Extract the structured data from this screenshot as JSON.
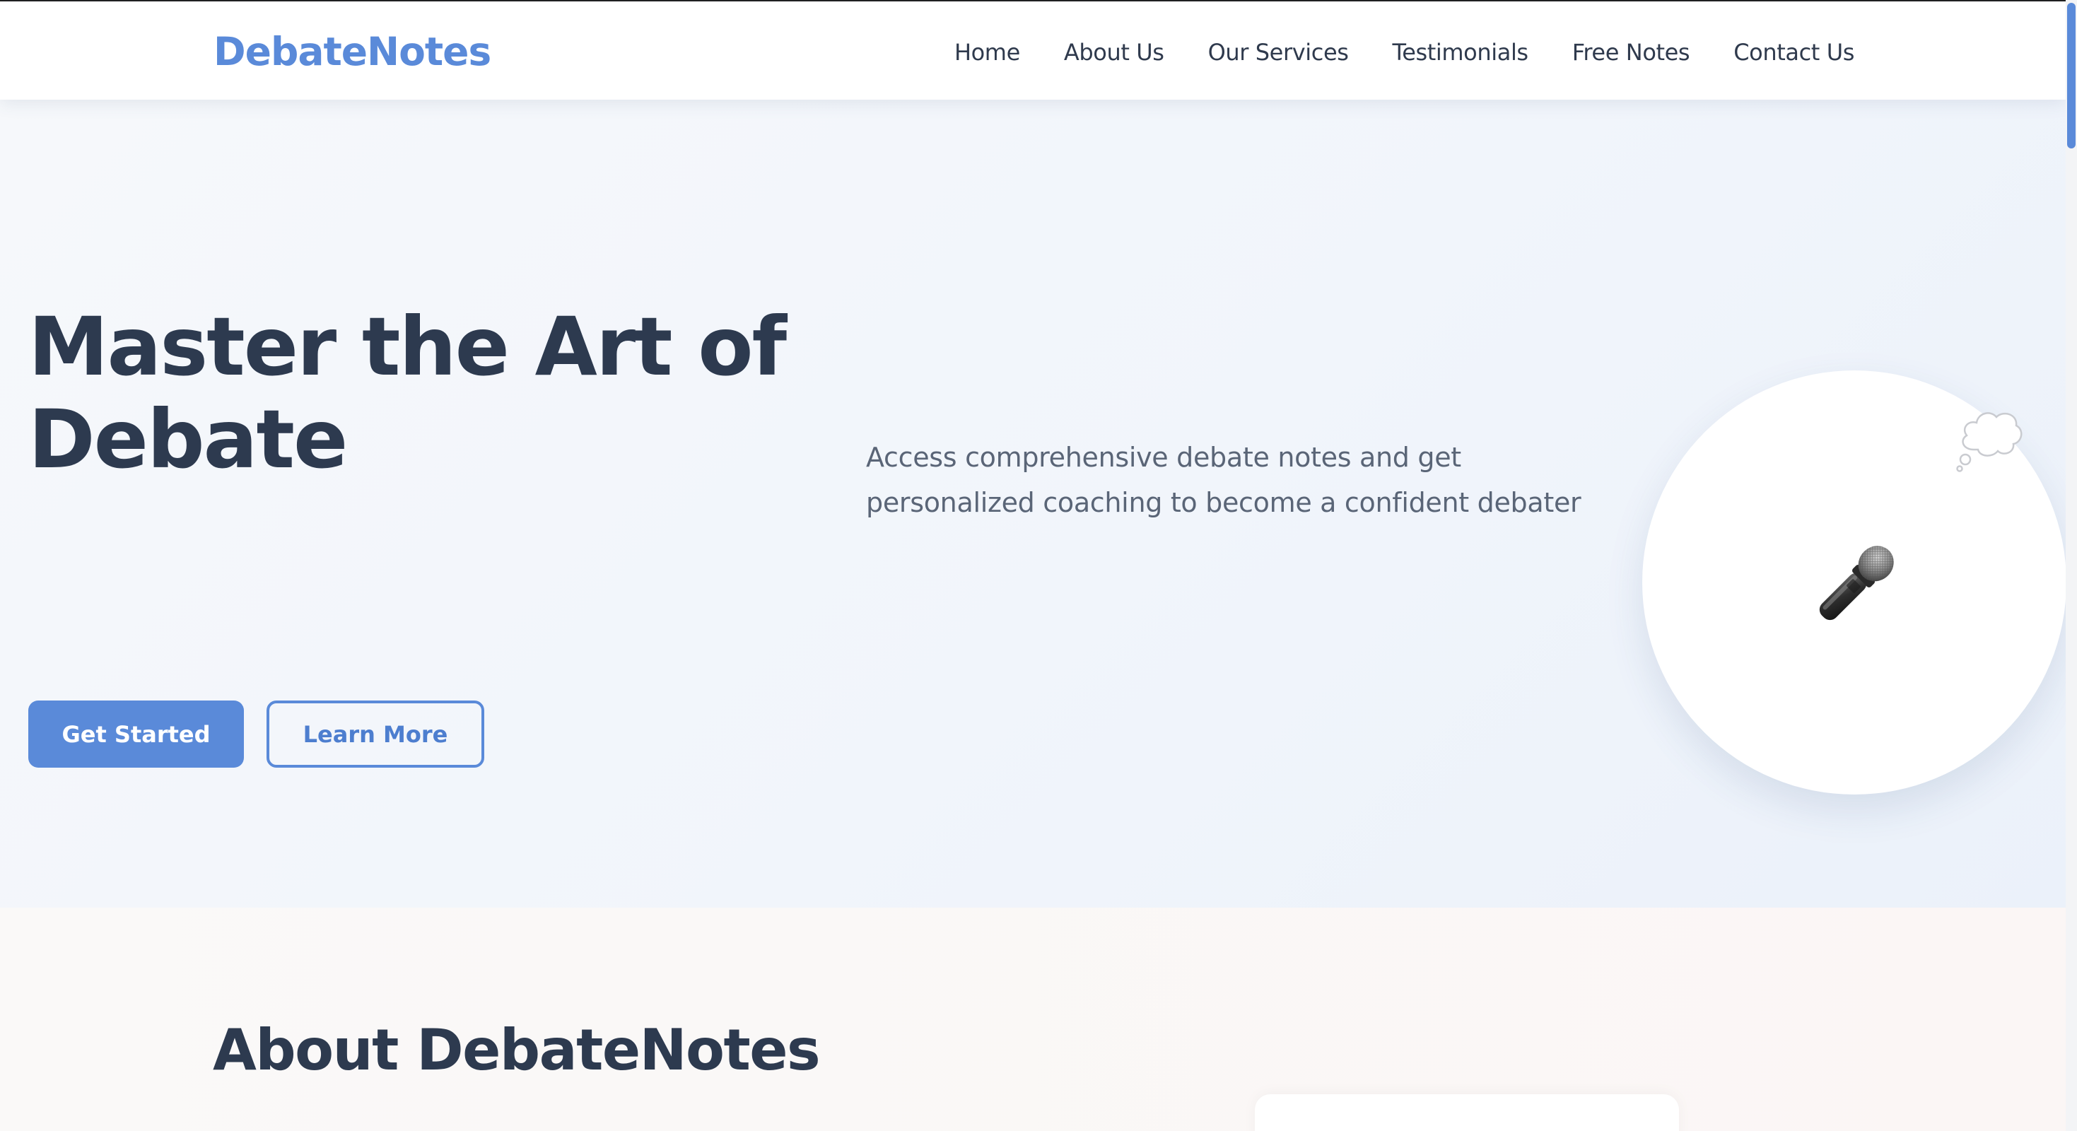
{
  "header": {
    "logo": "DebateNotes",
    "nav": {
      "home": "Home",
      "about": "About Us",
      "services": "Our Services",
      "testimonials": "Testimonials",
      "free_notes": "Free Notes",
      "contact": "Contact Us"
    }
  },
  "hero": {
    "title_line1": "Master the Art of",
    "title_line2": "Debate",
    "subtitle": "Access comprehensive debate notes and get personalized coaching to become a confident debater",
    "primary_button": "Get Started",
    "secondary_button": "Learn More",
    "illustration_icon": "microphone-icon",
    "floating_icon": "thought-bubble-icon"
  },
  "about": {
    "title": "About DebateNotes"
  },
  "colors": {
    "accent": "#5a8ad9",
    "heading": "#2d3a4f",
    "body_text": "#5a6577",
    "nav_text": "#2f3a4d"
  }
}
